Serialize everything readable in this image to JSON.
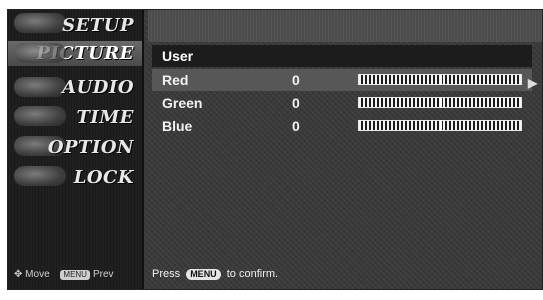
{
  "menu": {
    "items": [
      {
        "label": "SETUP"
      },
      {
        "label": "PICTURE"
      },
      {
        "label": "AUDIO"
      },
      {
        "label": "TIME"
      },
      {
        "label": "OPTION"
      },
      {
        "label": "LOCK"
      }
    ],
    "active_index": 1
  },
  "sidebar_footer": {
    "move_icon": "dpad-icon",
    "move_label": "Move",
    "menu_key": "MENU",
    "prev_label": "Prev"
  },
  "panel": {
    "title": "User",
    "rows": [
      {
        "name": "Red",
        "value": "0",
        "level": 0.5
      },
      {
        "name": "Green",
        "value": "0",
        "level": 0.5
      },
      {
        "name": "Blue",
        "value": "0",
        "level": 0.5
      }
    ],
    "selected_index": 0,
    "footer_prefix": "Press",
    "footer_key": "MENU",
    "footer_suffix": "to confirm."
  }
}
